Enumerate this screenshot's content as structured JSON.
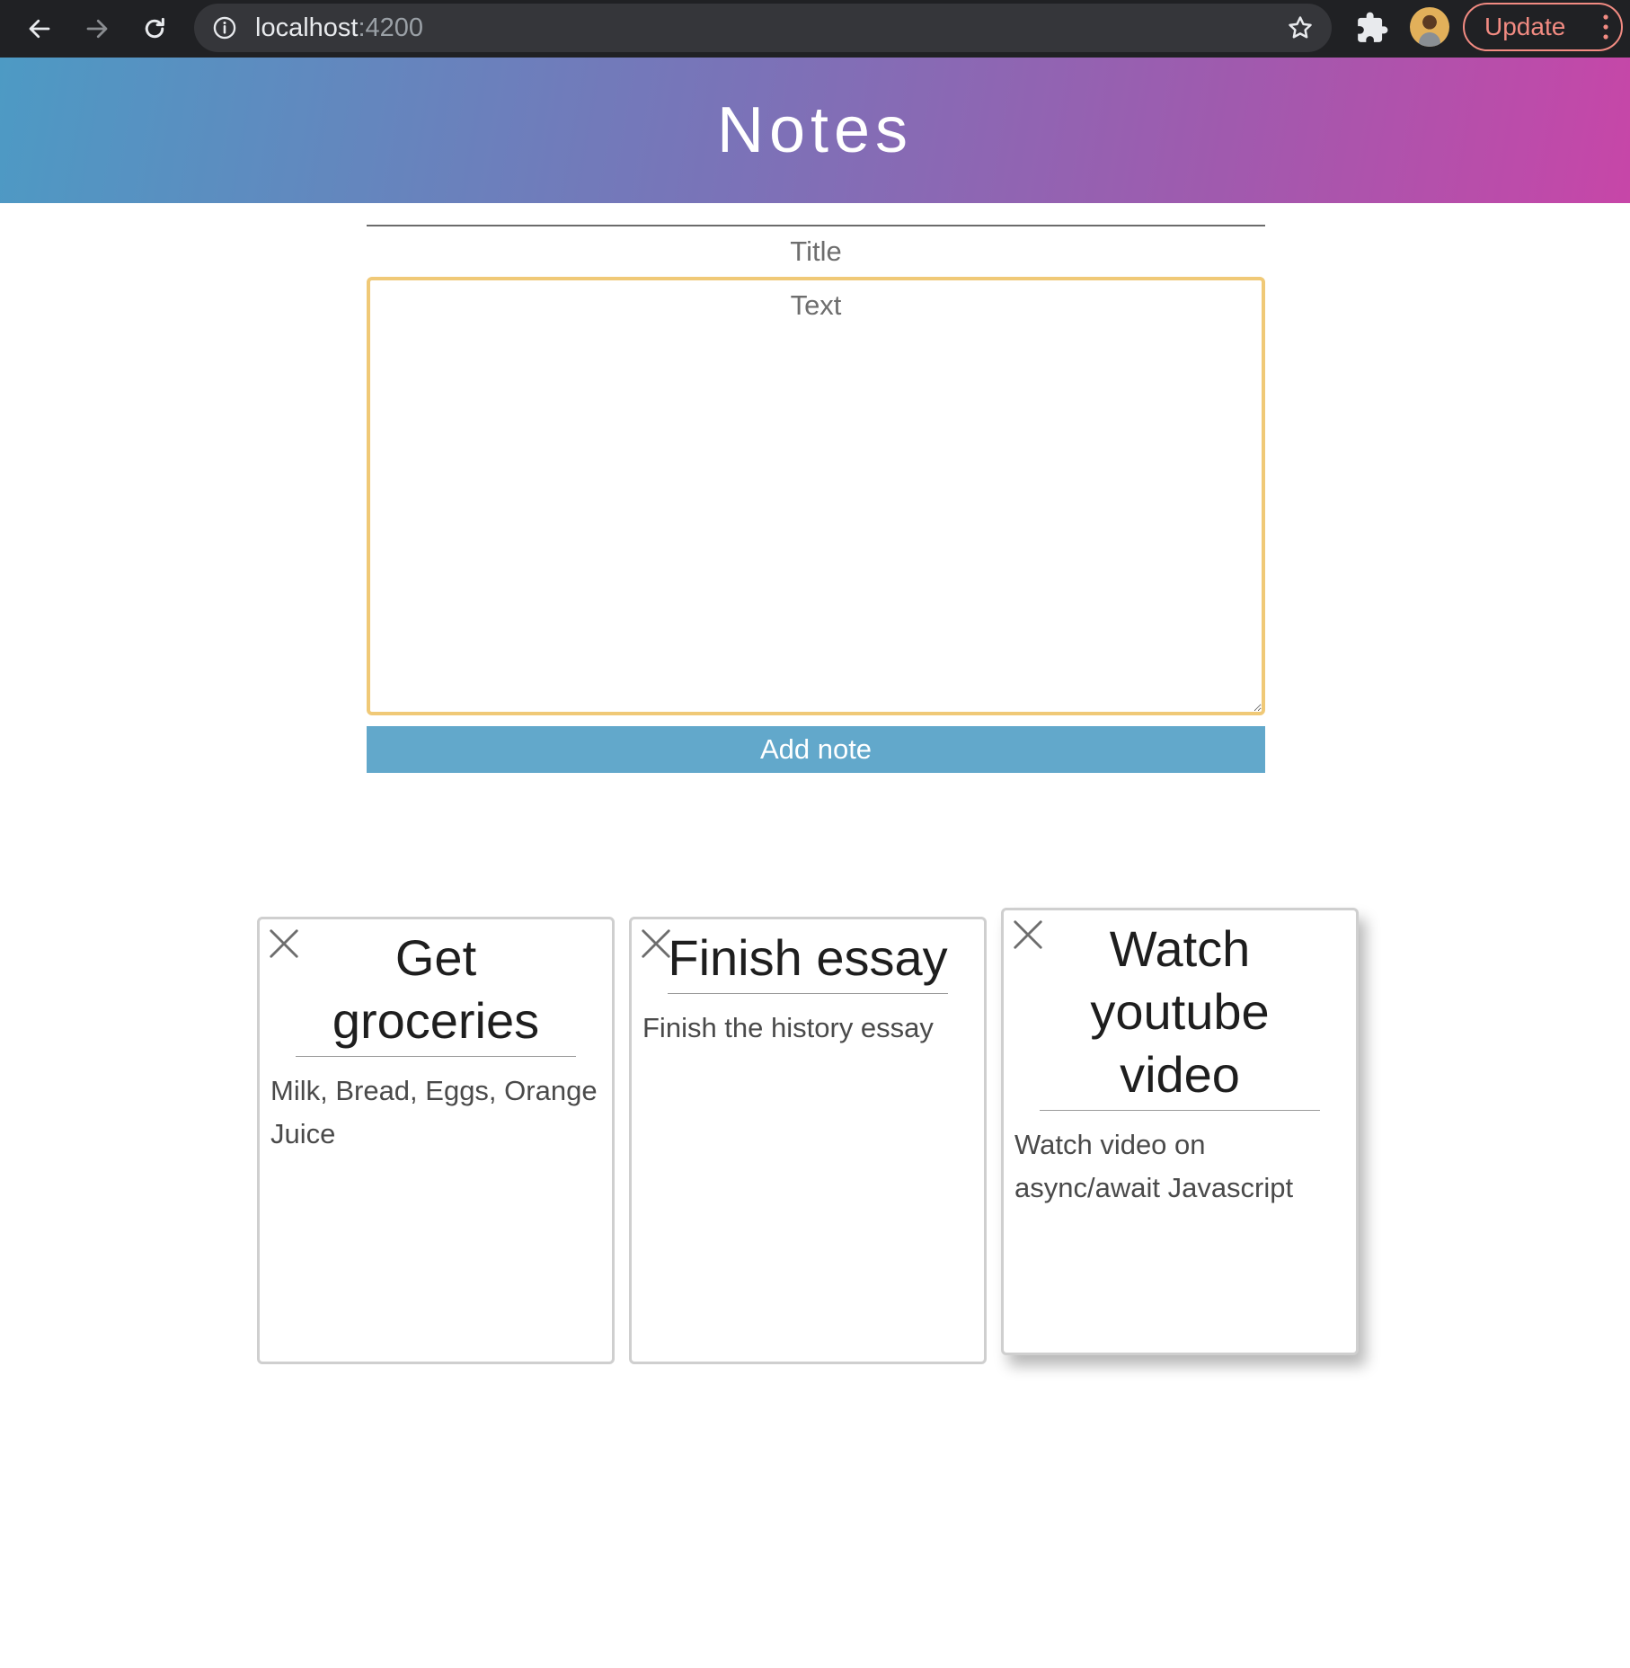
{
  "browser": {
    "url_host": "localhost",
    "url_port": ":4200",
    "update_label": "Update"
  },
  "app": {
    "title": "Notes"
  },
  "form": {
    "title_placeholder": "Title",
    "text_placeholder": "Text",
    "add_button_label": "Add note"
  },
  "notes": [
    {
      "title": "Get groceries",
      "body": "Milk, Bread, Eggs, Orange Juice"
    },
    {
      "title": "Finish essay",
      "body": "Finish the history essay"
    },
    {
      "title": "Watch youtube video",
      "body": "Watch video on async/await Javascript"
    }
  ],
  "colors": {
    "header_gradient": [
      "#4d9ac4",
      "#7a73b8",
      "#a05aae",
      "#c746a8"
    ],
    "add_button": "#62a8cb",
    "textarea_focus_border": "#f0c977",
    "update_accent": "#f28b82"
  }
}
